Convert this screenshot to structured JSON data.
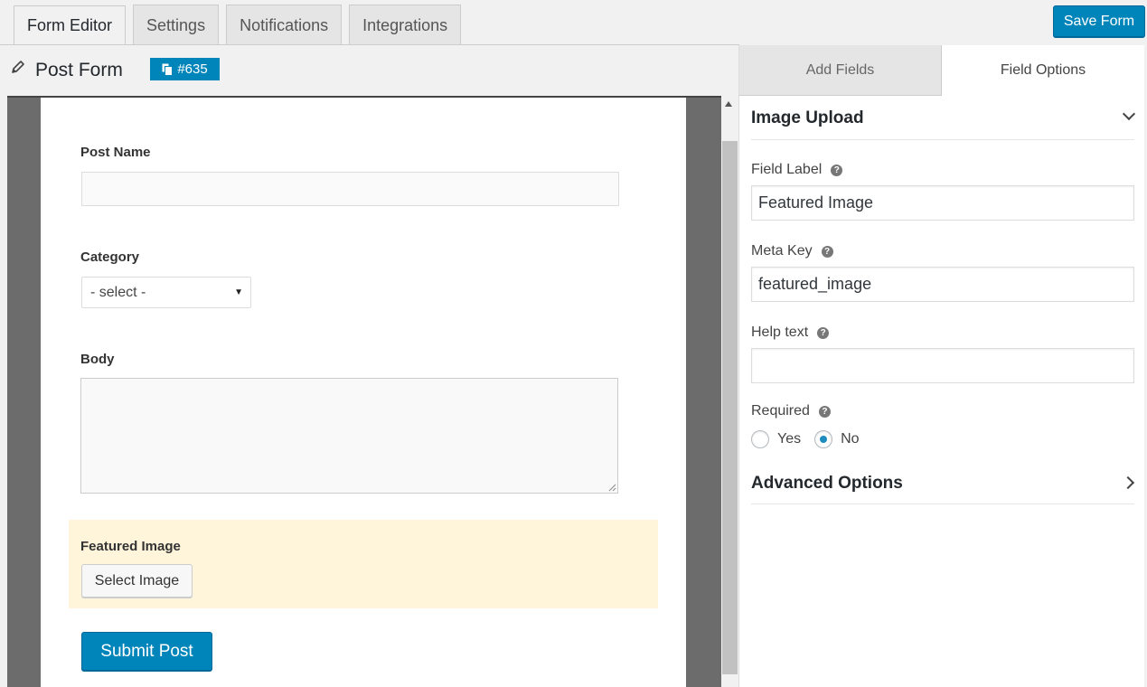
{
  "tabs": [
    {
      "label": "Form Editor",
      "active": true
    },
    {
      "label": "Settings",
      "active": false
    },
    {
      "label": "Notifications",
      "active": false
    },
    {
      "label": "Integrations",
      "active": false
    }
  ],
  "save_button": "Save Form",
  "form": {
    "title": "Post Form",
    "id_badge": "#635"
  },
  "fields": {
    "post_name_label": "Post Name",
    "category_label": "Category",
    "category_selected": "- select -",
    "body_label": "Body",
    "featured_image_label": "Featured Image",
    "select_image_button": "Select Image",
    "submit_button": "Submit Post"
  },
  "panel": {
    "tabs": {
      "add_fields": "Add Fields",
      "field_options": "Field Options",
      "active": "field_options"
    },
    "section_title": "Image Upload",
    "field_label_label": "Field Label",
    "field_label_value": "Featured Image",
    "meta_key_label": "Meta Key",
    "meta_key_value": "featured_image",
    "help_text_label": "Help text",
    "help_text_value": "",
    "required_label": "Required",
    "required_options": {
      "yes": "Yes",
      "no": "No",
      "selected": "No"
    },
    "advanced_options": "Advanced Options"
  },
  "colors": {
    "primary": "#0085ba",
    "highlight": "#fef5db",
    "canvas_bg": "#6c6c6c"
  }
}
